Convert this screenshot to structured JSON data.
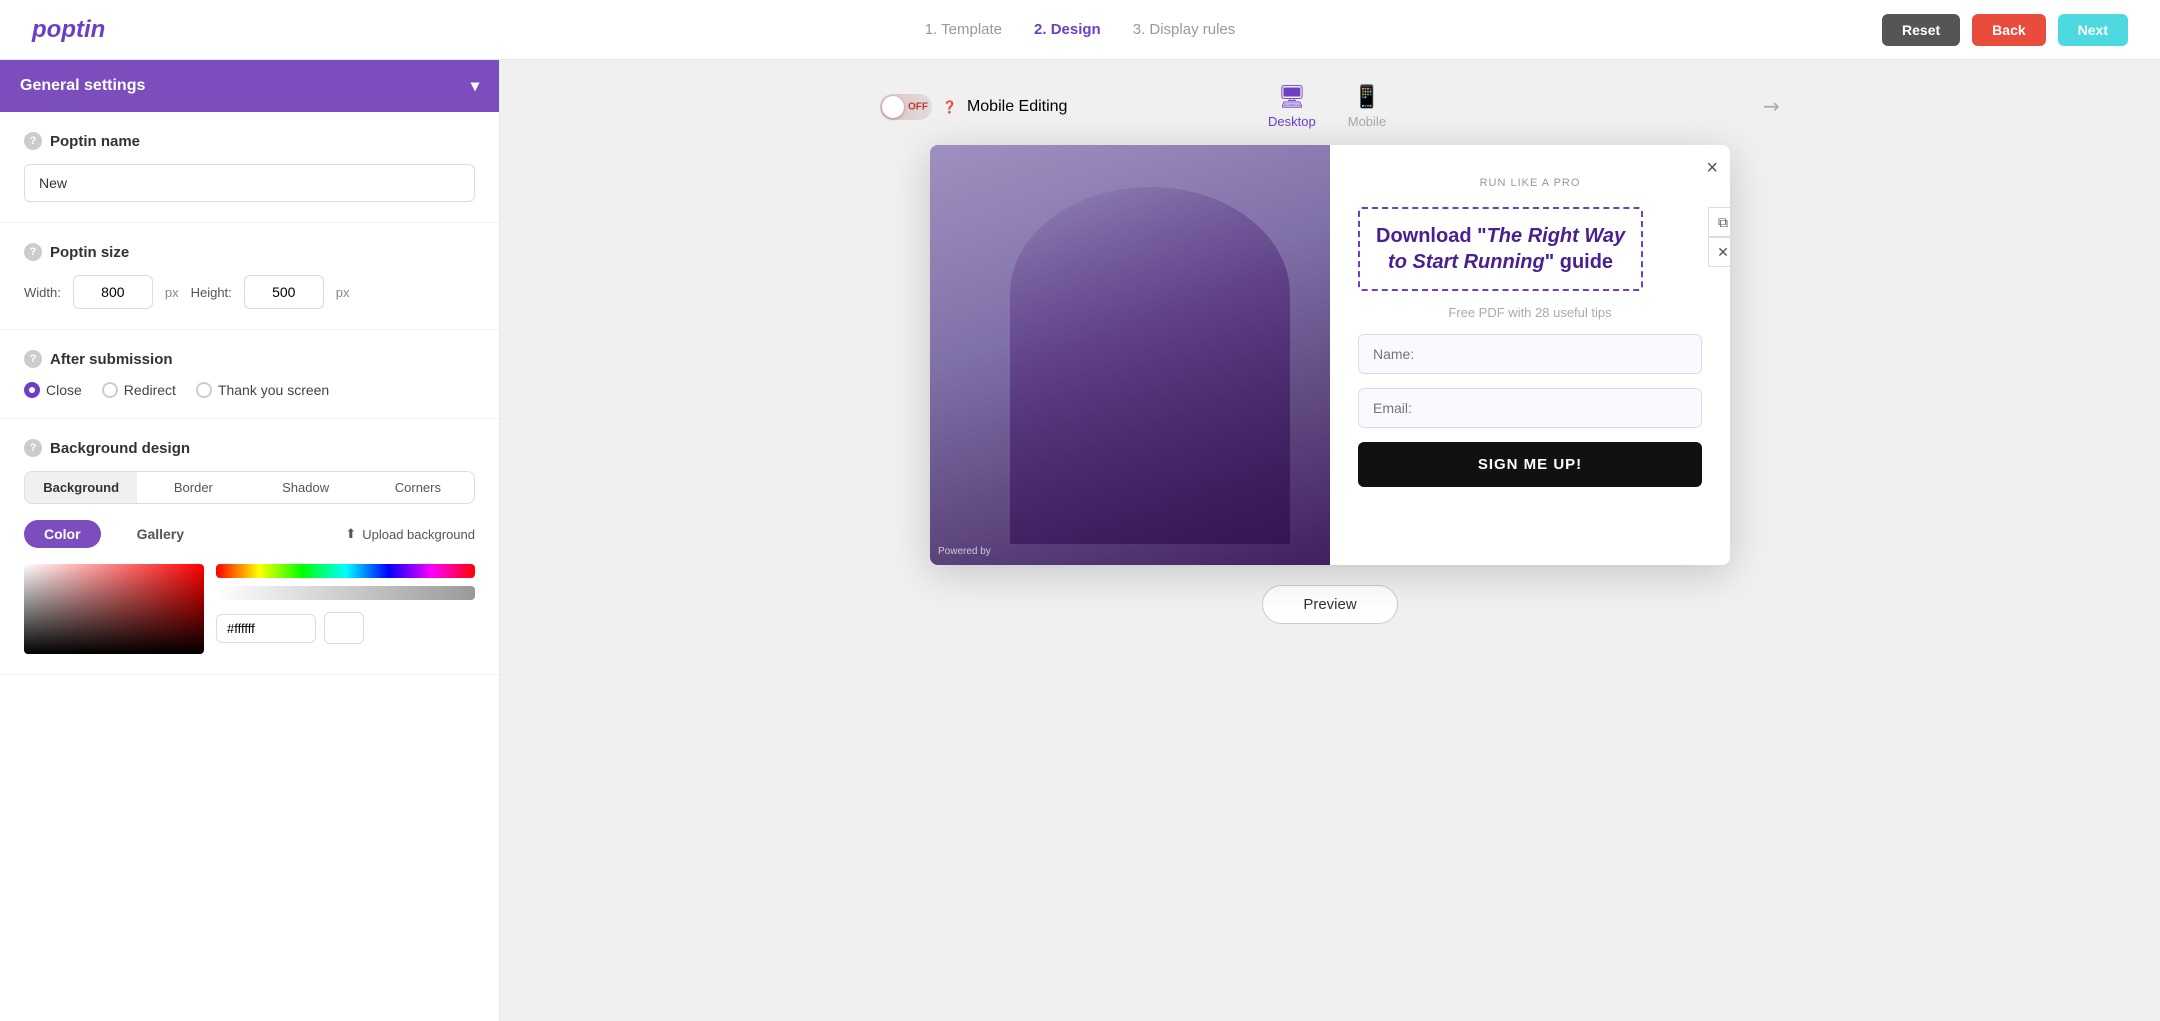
{
  "header": {
    "logo": "poptin",
    "steps": [
      {
        "id": "template",
        "label": "1. Template",
        "state": "inactive"
      },
      {
        "id": "design",
        "label": "2. Design",
        "state": "active"
      },
      {
        "id": "display",
        "label": "3. Display rules",
        "state": "inactive"
      }
    ],
    "reset_label": "Reset",
    "back_label": "Back",
    "next_label": "Next"
  },
  "left_panel": {
    "general_settings_label": "General settings",
    "poptin_name_label": "Poptin name",
    "poptin_name_value": "New",
    "poptin_size_label": "Poptin size",
    "width_label": "Width:",
    "width_value": "800",
    "height_label": "Height:",
    "height_value": "500",
    "px_label": "px",
    "after_submission_label": "After submission",
    "submission_options": [
      {
        "id": "close",
        "label": "Close",
        "selected": true
      },
      {
        "id": "redirect",
        "label": "Redirect",
        "selected": false
      },
      {
        "id": "thankyou",
        "label": "Thank you screen",
        "selected": false
      }
    ],
    "bg_design_label": "Background design",
    "bg_tabs": [
      {
        "id": "background",
        "label": "Background",
        "active": true
      },
      {
        "id": "border",
        "label": "Border",
        "active": false
      },
      {
        "id": "shadow",
        "label": "Shadow",
        "active": false
      },
      {
        "id": "corners",
        "label": "Corners",
        "active": false
      }
    ],
    "color_label": "Color",
    "gallery_label": "Gallery",
    "upload_label": "Upload background",
    "hex_value": "#ffffff"
  },
  "preview_area": {
    "mobile_editing_label": "Mobile Editing",
    "toggle_off_label": "OFF",
    "desktop_label": "Desktop",
    "mobile_label": "Mobile"
  },
  "popup": {
    "close_btn": "×",
    "subtitle": "RUN LIKE A PRO",
    "title_line1": "Download \"",
    "title_italic": "The Right Way to Start Running",
    "title_line2": "\" guide",
    "description": "Free PDF with 28 useful tips",
    "name_placeholder": "Name:",
    "email_placeholder": "Email:",
    "cta_label": "SIGN ME UP!",
    "powered_by": "Powered by"
  },
  "preview_btn_label": "Preview",
  "icons": {
    "help": "?",
    "chevron_down": "▾",
    "desktop": "🖥",
    "mobile": "📱",
    "expand": "↗",
    "copy": "⧉",
    "delete": "✕",
    "upload": "⬆"
  }
}
